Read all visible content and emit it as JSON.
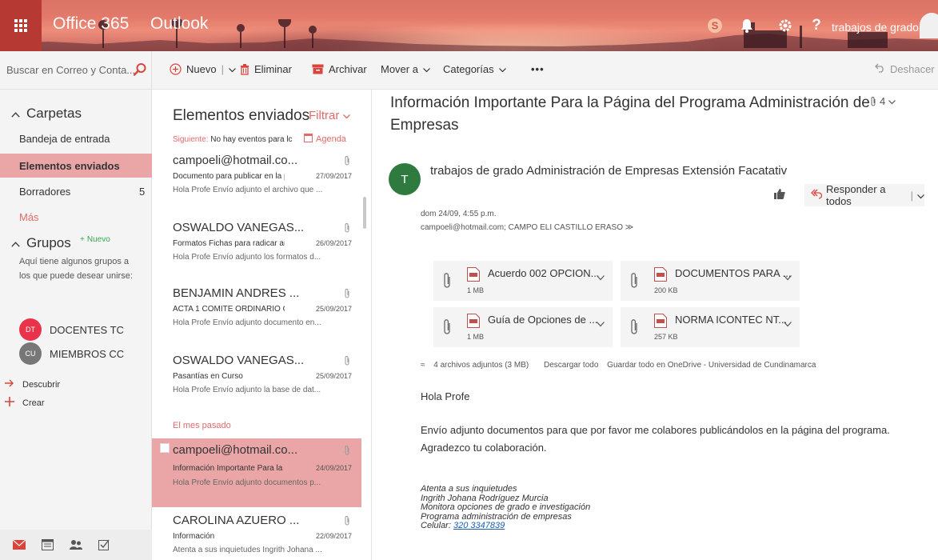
{
  "topbar": {
    "brand": "Office 365",
    "app": "Outlook",
    "user": "trabajos de grado...",
    "skype_icon": "skype-icon",
    "bell_icon": "bell-icon",
    "gear_icon": "gear-icon",
    "help_label": "?"
  },
  "search": {
    "placeholder": "Buscar en Correo y Conta..."
  },
  "commands": {
    "new": "Nuevo",
    "delete": "Eliminar",
    "archive": "Archivar",
    "move": "Mover a",
    "categories": "Categorías",
    "more": "•••",
    "undo": "Deshacer"
  },
  "nav": {
    "folders_header": "Carpetas",
    "folders": [
      {
        "label": "Bandeja de entrada",
        "count": ""
      },
      {
        "label": "Elementos enviados",
        "count": ""
      },
      {
        "label": "Borradores",
        "count": "5"
      }
    ],
    "more": "Más",
    "groups_header": "Grupos",
    "new_group": "Nuevo",
    "groups_note": "Aquí tiene algunos grupos a los que puede desear unirse:",
    "groups": [
      {
        "initials": "DT",
        "name": "DOCENTES TC",
        "color": "#e8334a"
      },
      {
        "initials": "CU",
        "name": "MIEMBROS CC",
        "color": "#777777"
      }
    ],
    "discover": "Descubrir",
    "create": "Crear"
  },
  "list": {
    "title": "Elementos enviados",
    "filter": "Filtrar",
    "next_label": "Siguiente:",
    "next_text": "No hay eventos para lc",
    "agenda": "Agenda",
    "section_last_month": "El mes pasado",
    "messages": [
      {
        "from": "campoeli@hotmail.co...",
        "subject": "Documento para publicar en la pá",
        "date": "27/09/2017",
        "preview": "Hola Profe  Envío adjunto el archivo que ..."
      },
      {
        "from": "OSWALDO VANEGAS...",
        "subject": "Formatos Fichas para radicar ante",
        "date": "26/09/2017",
        "preview": "Hola Profe  Envío adjunto los formatos d..."
      },
      {
        "from": "BENJAMIN ANDRES ...",
        "subject": "ACTA 1 COMITE ORDINARIO OPC",
        "date": "25/09/2017",
        "preview": "Hola Profe  Envío adjunto documento en..."
      },
      {
        "from": "OSWALDO VANEGAS...",
        "subject": "Pasantías en Curso",
        "date": "25/09/2017",
        "preview": "Hola Profe  Envío adjunto la base de dat..."
      },
      {
        "from": "campoeli@hotmail.co...",
        "subject": "Información Importante Para la Pá",
        "date": "24/09/2017",
        "preview": "Hola Profe  Envío adjunto documentos p..."
      },
      {
        "from": "CAROLINA AZUERO ...",
        "subject": "Información",
        "date": "22/09/2017",
        "preview": "Atenta a sus inquietudes  Ingrith Johana ..."
      }
    ]
  },
  "reading": {
    "subject": "Información Importante Para la Página del Programa Administración de Empresas",
    "attach_count": "4",
    "avatar_initial": "T",
    "sender": "trabajos de grado Administración de Empresas Extensión Facatativ",
    "reply_all": "Responder a todos",
    "date": "dom 24/09, 4:55 p.m.",
    "to": "campoeli@hotmail.com; CAMPO ELI CASTILLO ERASO",
    "attachments": [
      {
        "name": "Acuerdo 002 OPCION...",
        "size": "1 MB"
      },
      {
        "name": "DOCUMENTOS PARA ...",
        "size": "200 KB"
      },
      {
        "name": "Guía de Opciones de ...",
        "size": "1 MB"
      },
      {
        "name": "NORMA ICONTEC NT...",
        "size": "257 KB"
      }
    ],
    "attach_summary": "4 archivos adjuntos (3 MB)",
    "download_all": "Descargar todo",
    "save_onedrive": "Guardar todo en OneDrive - Universidad de Cundinamarca",
    "greeting": "Hola Profe",
    "body_line1": "Envío adjunto documentos para que por favor me colabores publicándolos en la página del programa.",
    "body_line2": "Agradezco tu colaboración.",
    "signature": [
      "Atenta a sus inquietudes",
      "Ingrith Johana Rodríguez Murcia",
      "Monitora opciones de grado e investigación",
      "Programa administración de empresas"
    ],
    "phone_label": "Celular:",
    "phone": "320 3347839"
  },
  "colors": {
    "accent": "#e26a6a",
    "selected": "#eaa6a6",
    "brand_bar": "#b63a33"
  }
}
